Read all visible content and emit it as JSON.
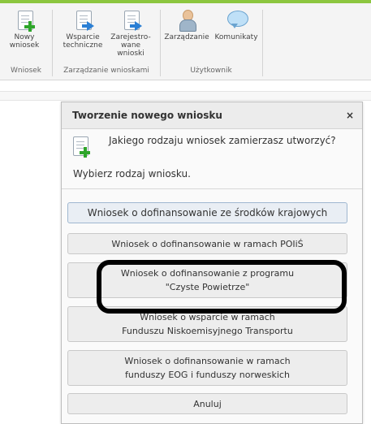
{
  "ribbon": {
    "groups": [
      {
        "label": "Wniosek",
        "buttons": [
          {
            "label": "Nowy wniosek",
            "icon": "new-document-icon"
          }
        ]
      },
      {
        "label": "Zarządzanie wnioskami",
        "buttons": [
          {
            "label": "Wsparcie techniczne",
            "icon": "document-arrow-icon"
          },
          {
            "label": "Zarejestro-wane wnioski",
            "icon": "document-arrow-icon"
          }
        ]
      },
      {
        "label": "Użytkownik",
        "buttons": [
          {
            "label": "Zarządzanie",
            "icon": "user-icon"
          },
          {
            "label": "Komunikaty",
            "icon": "speech-bubble-icon"
          }
        ]
      }
    ]
  },
  "dialog": {
    "title": "Tworzenie nowego wniosku",
    "close": "×",
    "question": "Jakiego rodzaju wniosek zamierzasz utworzyć?",
    "instruction": "Wybierz rodzaj wniosku.",
    "options": [
      {
        "line1": "Wniosek o dofinansowanie ze środków krajowych",
        "line2": ""
      },
      {
        "line1": "Wniosek o dofinansowanie w ramach POIiŚ",
        "line2": ""
      },
      {
        "line1": "Wniosek o dofinansowanie z programu",
        "line2": "\"Czyste Powietrze\""
      },
      {
        "line1": "Wniosek o wsparcie w ramach",
        "line2": "Funduszu Niskoemisyjnego Transportu"
      },
      {
        "line1": "Wniosek o dofinansowanie w ramach",
        "line2": "funduszy EOG i funduszy norweskich"
      },
      {
        "line1": "Anuluj",
        "line2": ""
      }
    ]
  },
  "colors": {
    "accent": "#8cc63f",
    "highlight": "#000000"
  }
}
